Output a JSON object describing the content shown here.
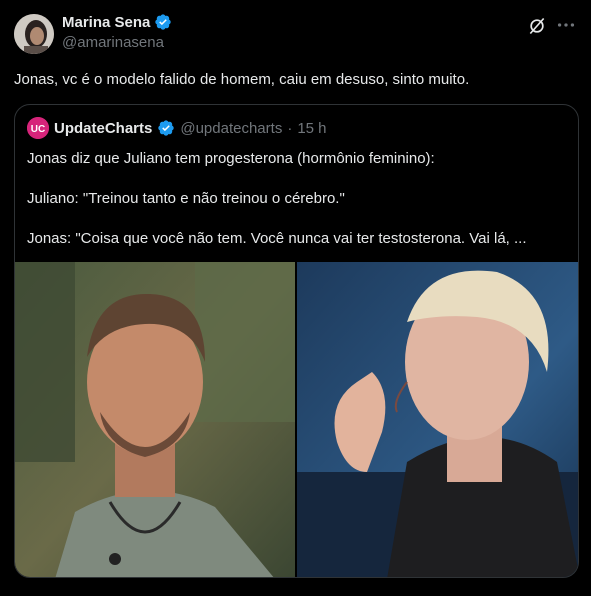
{
  "post": {
    "author_name": "Marina Sena",
    "author_handle": "@amarinasena",
    "text": "Jonas, vc é o modelo falido de homem, caiu em desuso, sinto muito."
  },
  "quoted_post": {
    "author_name": "UpdateCharts",
    "author_handle": "@updatecharts",
    "separator": "·",
    "time": "15 h",
    "lines": [
      "Jonas diz que Juliano tem progesterona (hormônio feminino):",
      "Juliano: \"Treinou tanto e não treinou o cérebro.\"",
      "Jonas: \"Coisa que você não tem. Você nunca vai ter testosterona. Vai lá, ..."
    ],
    "avatar_logo": "UC"
  },
  "icons": {
    "verified": "verified-badge-icon",
    "grok": "grok-icon",
    "more": "more-icon"
  },
  "colors": {
    "verified_blue": "#1d9bf0",
    "background": "#000000",
    "text": "#e7e9ea",
    "muted": "#71767b",
    "border": "#2f3336",
    "quoted_avatar": "#d6247a"
  }
}
